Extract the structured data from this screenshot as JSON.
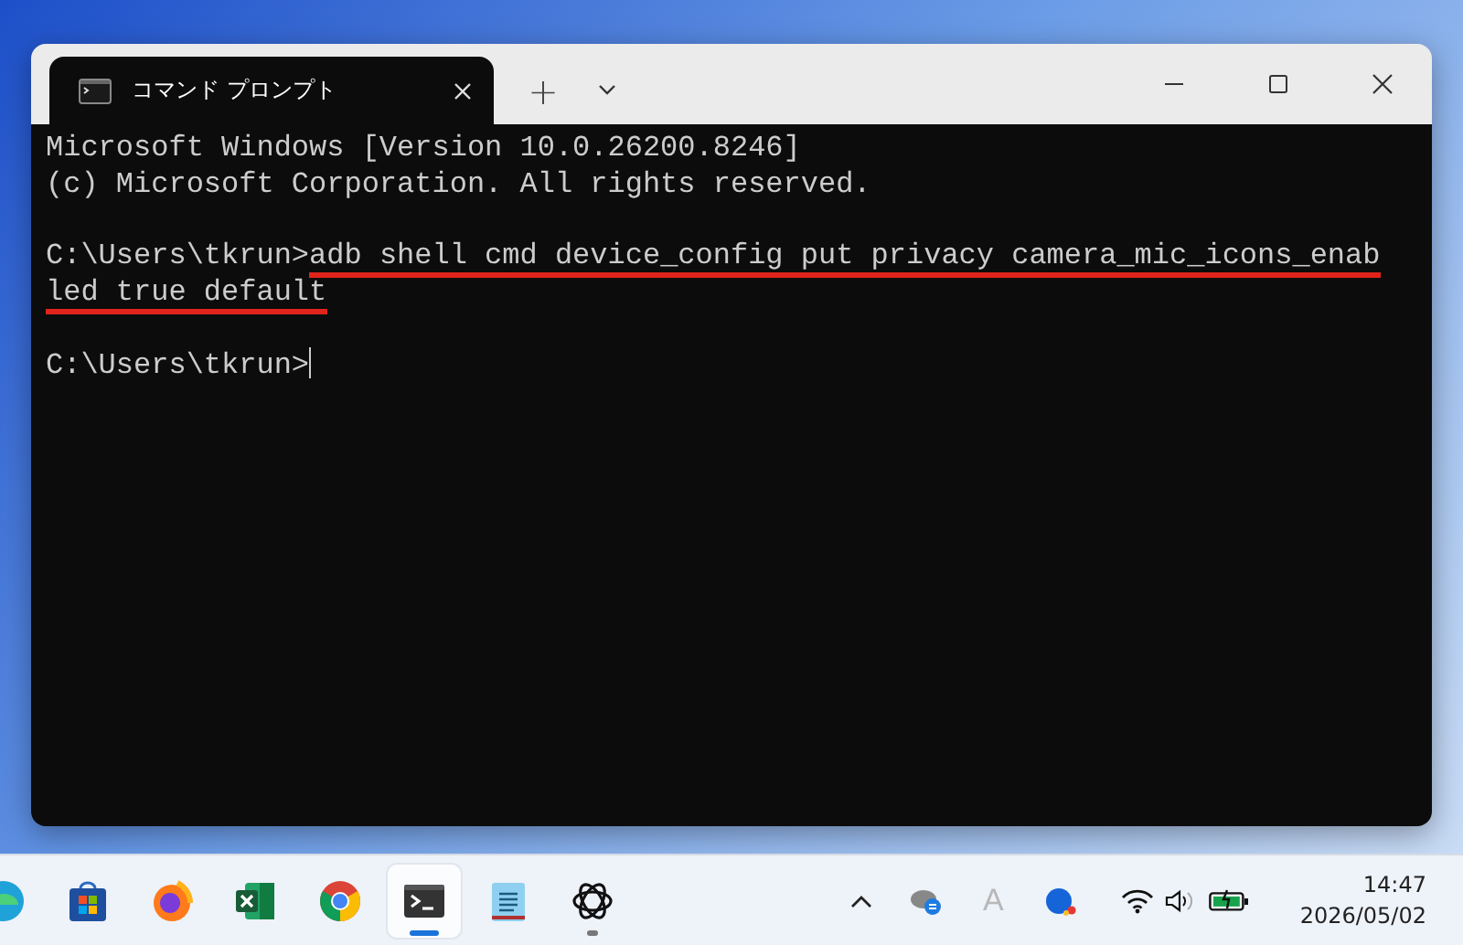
{
  "window": {
    "tabs": [
      {
        "title": "コマンド プロンプト",
        "selected": true
      }
    ],
    "new_tab": "+"
  },
  "terminal": {
    "blocks": [
      [
        {
          "text": "Microsoft Windows [Version 10.0.26200.8246]"
        },
        {
          "text": "(c) Microsoft Corporation. All rights reserved."
        }
      ],
      [
        {
          "prompt": "C:\\Users\\tkrun>",
          "command": "adb shell cmd device_config put privacy camera_mic_icons_enab",
          "highlighted": true
        },
        {
          "command": "led true default",
          "highlighted": true
        }
      ],
      [
        {
          "prompt": "C:\\Users\\tkrun>",
          "cursor": true
        }
      ]
    ]
  },
  "taskbar": {
    "apps": [
      {
        "selected": false,
        "running": false
      },
      {
        "selected": false,
        "running": false
      },
      {
        "selected": false,
        "running": false
      },
      {
        "selected": false,
        "running": false
      },
      {
        "selected": false,
        "running": false
      },
      {
        "selected": true,
        "running": true
      },
      {
        "selected": false,
        "running": false
      },
      {
        "selected": false,
        "running": true
      }
    ],
    "ime": "A",
    "time": "14:47",
    "date": "2026/05/02"
  }
}
